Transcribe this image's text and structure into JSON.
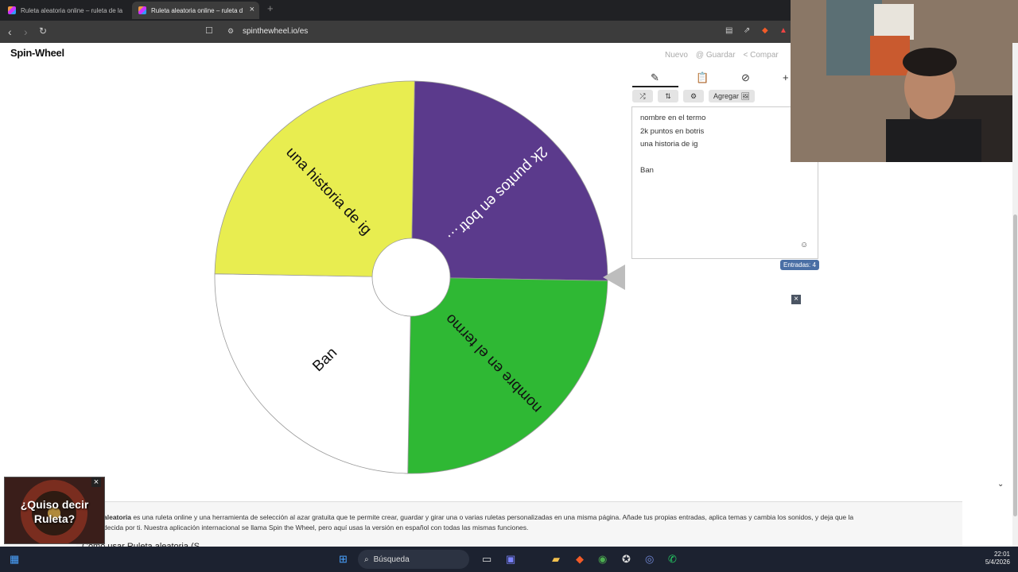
{
  "browser": {
    "tabs": [
      {
        "title": "Ruleta aleatoria online – ruleta de la"
      },
      {
        "title": "Ruleta aleatoria online – ruleta d"
      }
    ],
    "url": "spinthewheel.io/es"
  },
  "app": {
    "logo": "Spin-Wheel",
    "actions": {
      "new": "Nuevo",
      "save": "@ Guardar",
      "share": "< Compar"
    }
  },
  "wheel": {
    "segments": [
      {
        "label": "2k puntos en botr…",
        "color": "#5b3a8c",
        "text_color": "#ffffff"
      },
      {
        "label": "nombre en el termo",
        "color": "#2fb834",
        "text_color": "#111111"
      },
      {
        "label": "Ban",
        "color": "#ffffff",
        "text_color": "#111111"
      },
      {
        "label": "una historia de ig",
        "color": "#e8ed50",
        "text_color": "#111111"
      }
    ]
  },
  "panel": {
    "add_label": "Agregar 🖼",
    "entries": [
      "nombre en el termo",
      "2k puntos en botris",
      "una historia de ig",
      "",
      "Ban"
    ],
    "count_label": "Entradas: 4"
  },
  "description": {
    "bold": "aleatoria",
    "line1": " es una ruleta online y una herramienta de selección al azar gratuita que te permite crear, guardar y girar una o varias ruletas personalizadas en una misma página. Añade tus propias entradas, aplica temas y cambia los sonidos, y deja que la",
    "line2": "decida por ti. Nuestra aplicación internacional se llama Spin the Wheel, pero aquí usas la versión en español con todas las mismas funciones.",
    "heading": "Cómo usar Ruleta aleatoria (S"
  },
  "ad": {
    "text": "¿Quiso decir Ruleta?"
  },
  "taskbar": {
    "search": "Búsqueda",
    "time": "22:01",
    "date": "5/4/2026"
  }
}
